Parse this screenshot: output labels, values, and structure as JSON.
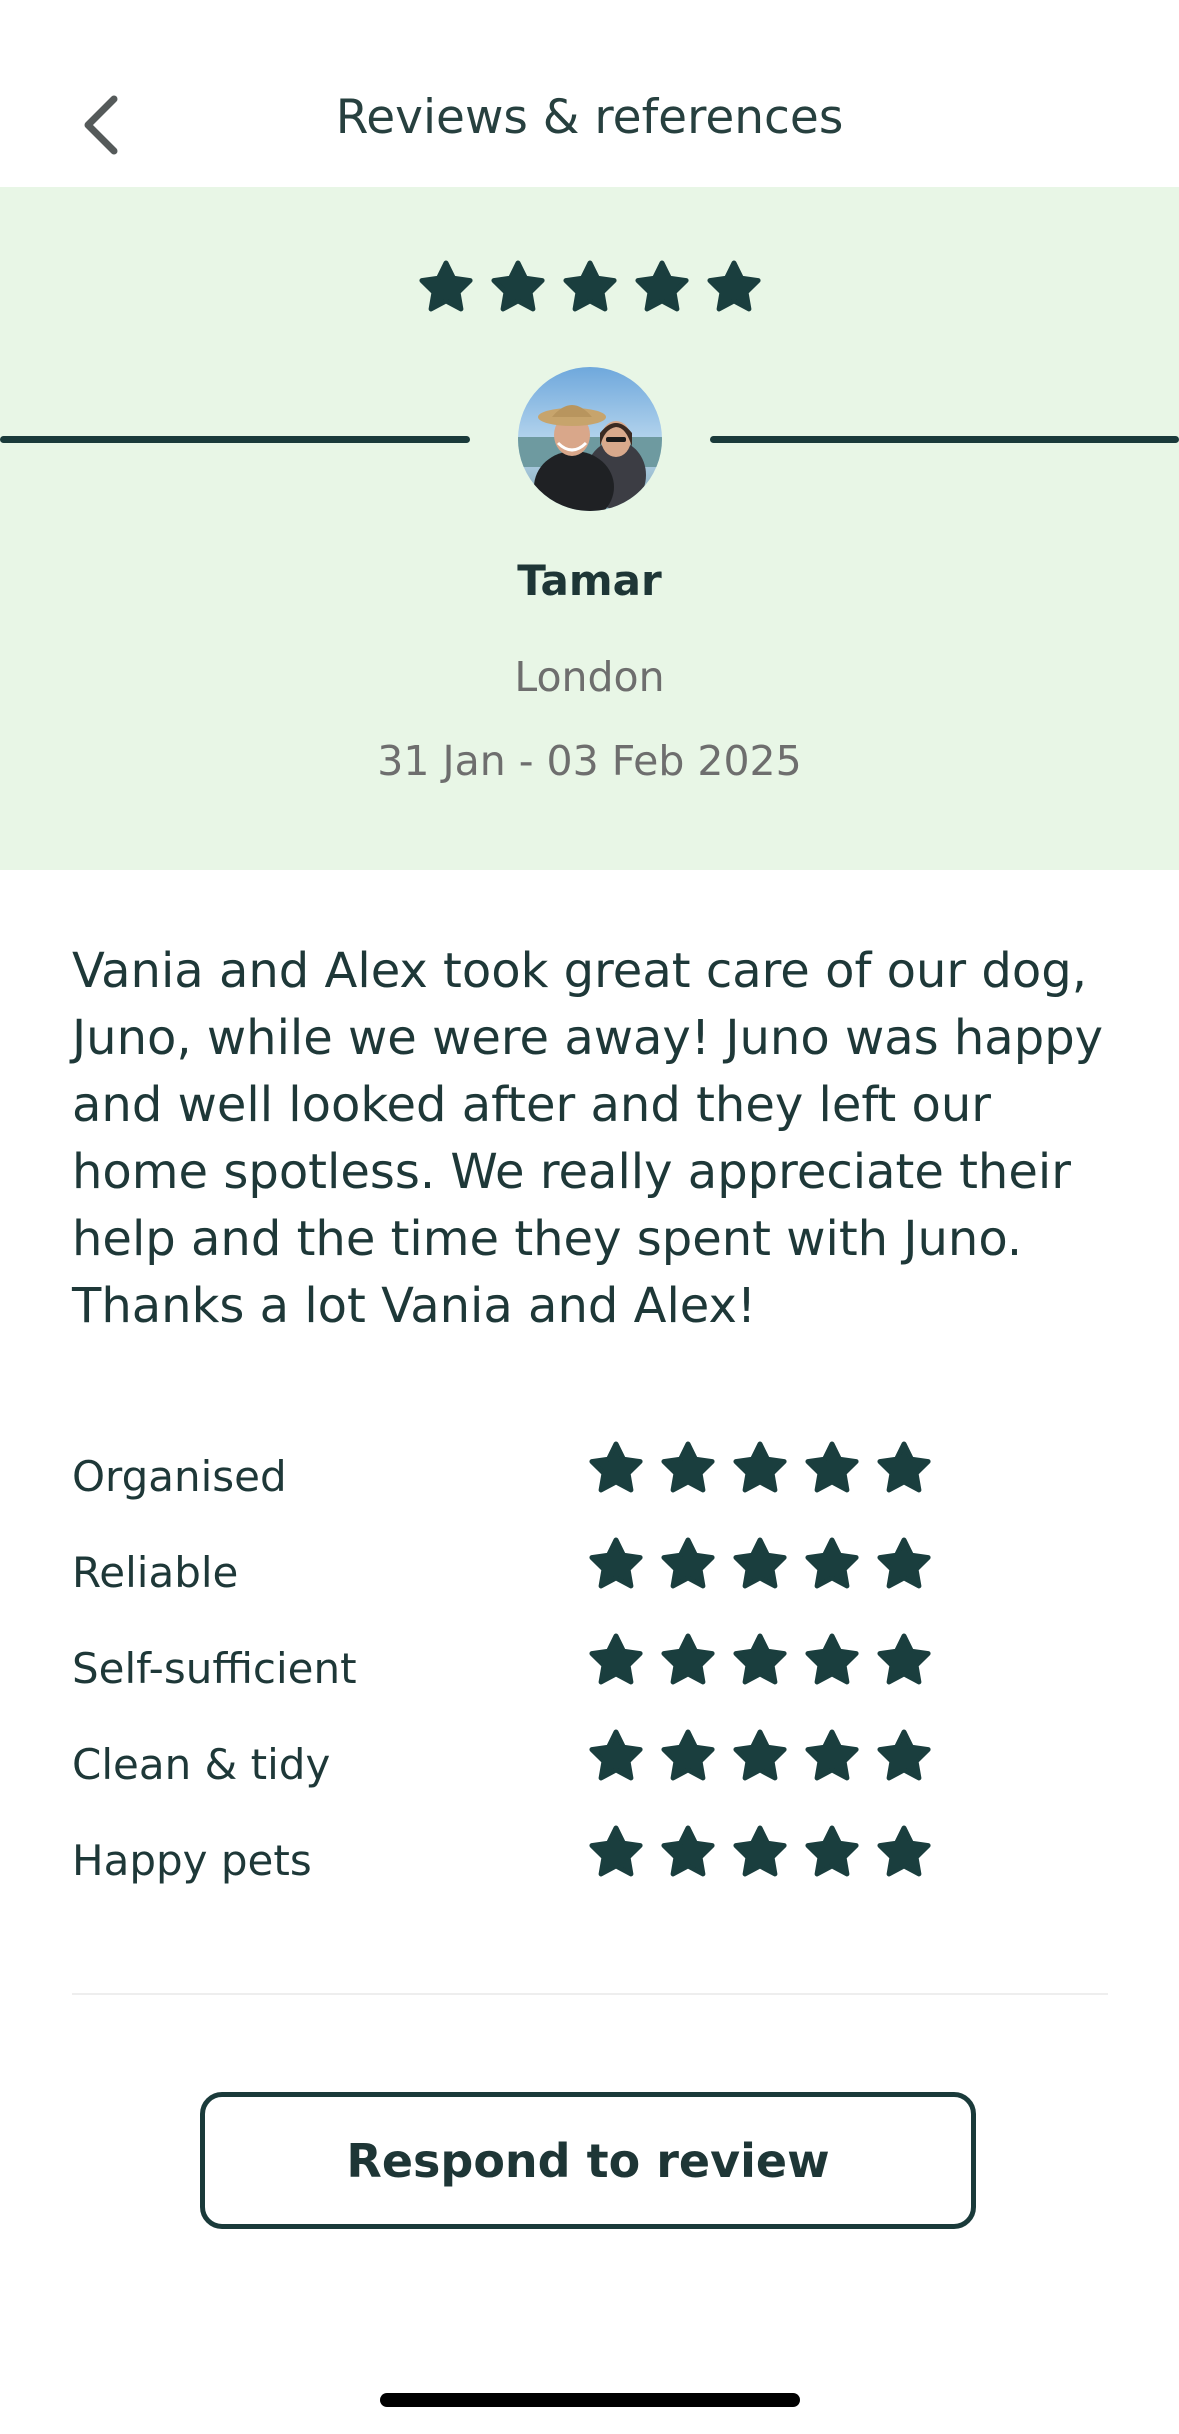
{
  "header": {
    "title": "Reviews & references",
    "back_icon": "chevron-left-icon"
  },
  "review": {
    "overall_rating": 5,
    "reviewer": {
      "name": "Tamar",
      "location": "London",
      "dates": "31 Jan - 03 Feb 2025"
    },
    "text": "Vania and Alex took great care of our dog, Juno, while we were away! Juno was happy and well looked after and they left our home spotless. We really appreciate their help and the time they spent with Juno. Thanks a lot Vania and Alex!",
    "categories": [
      {
        "label": "Organised",
        "rating": 5
      },
      {
        "label": "Reliable",
        "rating": 5
      },
      {
        "label": "Self-sufficient",
        "rating": 5
      },
      {
        "label": "Clean & tidy",
        "rating": 5
      },
      {
        "label": "Happy pets",
        "rating": 5
      }
    ]
  },
  "actions": {
    "respond_label": "Respond to review"
  },
  "colors": {
    "hero_background": "#e8f6e6",
    "star": "#1a3e3e",
    "text_primary": "#1e3838",
    "text_muted": "#6e6e6e"
  }
}
